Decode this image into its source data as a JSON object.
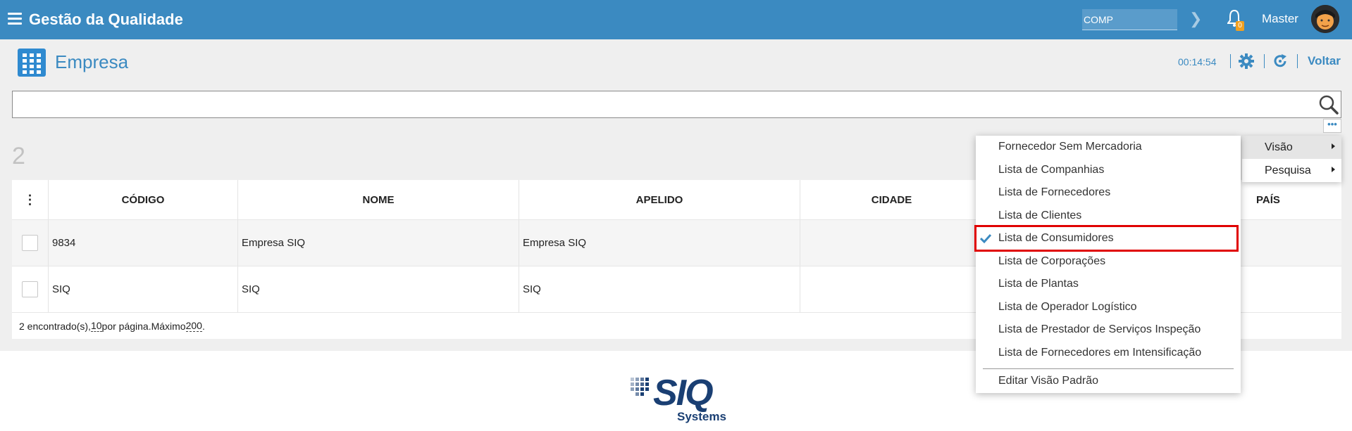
{
  "header": {
    "app_title": "Gestão da Qualidade",
    "company_field_value": "COMP",
    "notification_count": "0",
    "user_name": "Master"
  },
  "page": {
    "title": "Empresa",
    "timer": "00:14:54",
    "back_label": "Voltar"
  },
  "search": {
    "value": "",
    "placeholder": ""
  },
  "results_count": "2",
  "table": {
    "columns": [
      "CÓDIGO",
      "NOME",
      "APELIDO",
      "CIDADE",
      "PAÍS"
    ],
    "rows": [
      {
        "codigo": "9834",
        "nome": "Empresa SIQ",
        "apelido": "Empresa SIQ"
      },
      {
        "codigo": "SIQ",
        "nome": "SIQ",
        "apelido": "SIQ"
      }
    ],
    "footer": {
      "prefix": "2 encontrado(s), ",
      "per_page": "10",
      "middle": " por página.Máximo ",
      "max": "200",
      "suffix": "."
    }
  },
  "view_menu": {
    "items": [
      {
        "label": "Visão",
        "active": true
      },
      {
        "label": "Pesquisa",
        "active": false
      }
    ]
  },
  "view_list": {
    "items": [
      "Fornecedor Sem Mercadoria",
      "Lista de Companhias",
      "Lista de Fornecedores",
      "Lista de Clientes",
      "Lista de Consumidores",
      "Lista de Corporações",
      "Lista de Plantas",
      "Lista de Operador Logístico",
      "Lista de Prestador de Serviços Inspeção",
      "Lista de Fornecedores em Intensificação"
    ],
    "selected": "Lista de Consumidores",
    "edit_default": "Editar Visão Padrão"
  },
  "logo": {
    "brand": "SIQ",
    "sub": "Systems"
  },
  "colors": {
    "primary": "#3b8ac1",
    "highlight": "#e00000",
    "logo": "#1a3f73"
  }
}
